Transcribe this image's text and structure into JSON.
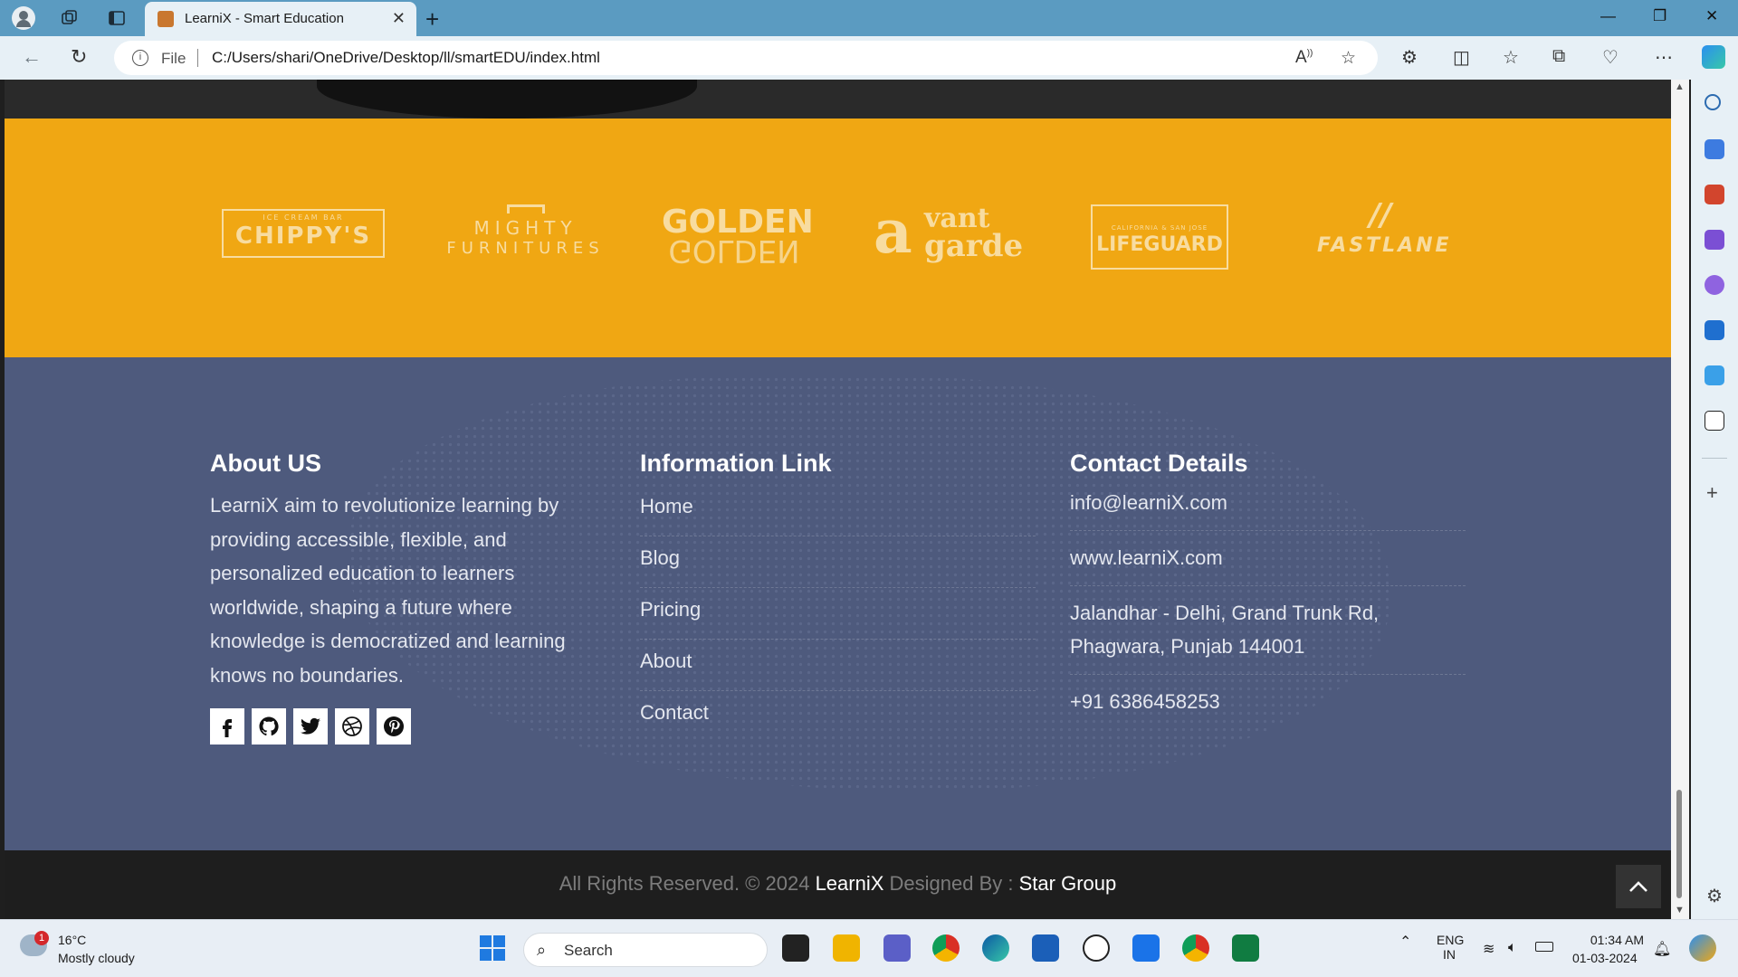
{
  "browser": {
    "tab_title": "LearniX - Smart Education",
    "file_label": "File",
    "url": "C:/Users/shari/OneDrive/Desktop/ll/smartEDU/index.html"
  },
  "brands": [
    {
      "name": "CHIPPY'S",
      "tagline": "ICE CREAM BAR"
    },
    {
      "name": "MIGHTY",
      "sub": "FURNITURES"
    },
    {
      "name": "GOLDEN",
      "sub": "GOLDEN"
    },
    {
      "name": "vant",
      "sub": "garde",
      "initial": "a"
    },
    {
      "name": "LIFEGUARD",
      "tagline": "CALIFORNIA & SAN JOSE"
    },
    {
      "name": "FASTLANE"
    }
  ],
  "footer": {
    "about": {
      "heading": "About US",
      "text": "LearniX aim to revolutionize learning by providing accessible, flexible, and personalized education to learners worldwide, shaping a future where knowledge is democratized and learning knows no boundaries."
    },
    "social": [
      "facebook-icon",
      "github-icon",
      "twitter-icon",
      "dribbble-icon",
      "pinterest-icon"
    ],
    "links": {
      "heading": "Information Link",
      "items": [
        "Home",
        "Blog",
        "Pricing",
        "About",
        "Contact"
      ]
    },
    "contact": {
      "heading": "Contact Details",
      "email": "info@learniX.com",
      "website": "www.learniX.com",
      "address": "Jalandhar - Delhi, Grand Trunk Rd, Phagwara, Punjab 144001",
      "phone": "+91 6386458253"
    }
  },
  "copyright": {
    "prefix": "All Rights Reserved. © 2024",
    "brand": "LearniX",
    "middle": "Designed By :",
    "designer": "Star Group"
  },
  "taskbar": {
    "weather_temp": "16°C",
    "weather_desc": "Mostly cloudy",
    "weather_badge": "1",
    "search_label": "Search",
    "lang": "ENG",
    "region": "IN",
    "time": "01:34 AM",
    "date": "01-03-2024"
  },
  "colors": {
    "brand_band": "#f0a713",
    "footer_bg": "#4e5a7d",
    "copyright_bg": "#1e1e1e"
  }
}
